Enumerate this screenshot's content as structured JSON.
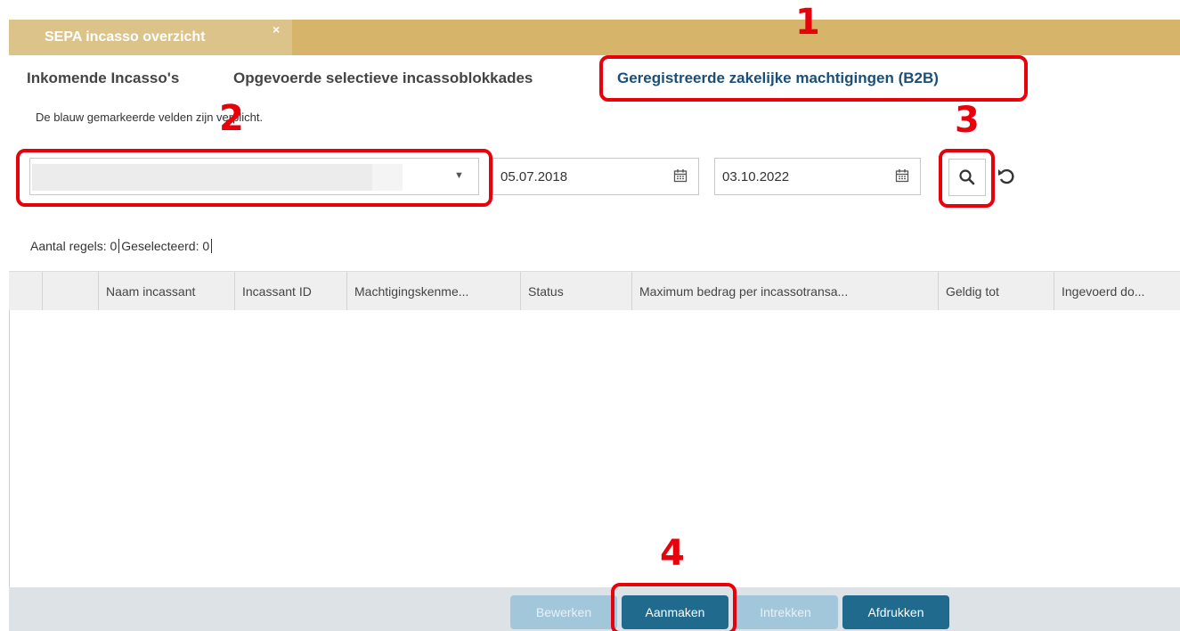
{
  "window": {
    "tab_title": "SEPA incasso overzicht",
    "close_glyph": "×"
  },
  "subtabs": [
    {
      "label": "Inkomende Incasso's",
      "active": false
    },
    {
      "label": "Opgevoerde selectieve incassoblokkades",
      "active": false
    },
    {
      "label": "Geregistreerde zakelijke machtigingen (B2B)",
      "active": true
    }
  ],
  "form": {
    "hint": "De blauw gemarkeerde velden zijn verplicht.",
    "account_select": {
      "value": "",
      "icon": "chevron-down-icon"
    },
    "date_from": "05.07.2018",
    "date_to": "03.10.2022",
    "search_icon": "search-icon",
    "reset_icon": "refresh-icon"
  },
  "summary": {
    "rows_label": "Aantal regels: 0",
    "selected_label": "Geselecteerd: 0"
  },
  "table": {
    "columns": [
      "Naam incassant",
      "Incassant ID",
      "Machtigingskenme...",
      "Status",
      "Maximum bedrag per incassotransa...",
      "Geldig tot",
      "Ingevoerd do..."
    ],
    "rows": []
  },
  "footer_buttons": [
    {
      "label": "Bewerken",
      "enabled": false
    },
    {
      "label": "Aanmaken",
      "enabled": true
    },
    {
      "label": "Intrekken",
      "enabled": false
    },
    {
      "label": "Afdrukken",
      "enabled": true
    }
  ],
  "annotations": [
    "1",
    "2",
    "3",
    "4"
  ],
  "colors": {
    "tab_bar": "#d6b46a",
    "active_subtab": "#1b4f78",
    "primary_button": "#1f6a8d",
    "disabled_button": "#a3c7da",
    "annotation": "#e8000b"
  }
}
